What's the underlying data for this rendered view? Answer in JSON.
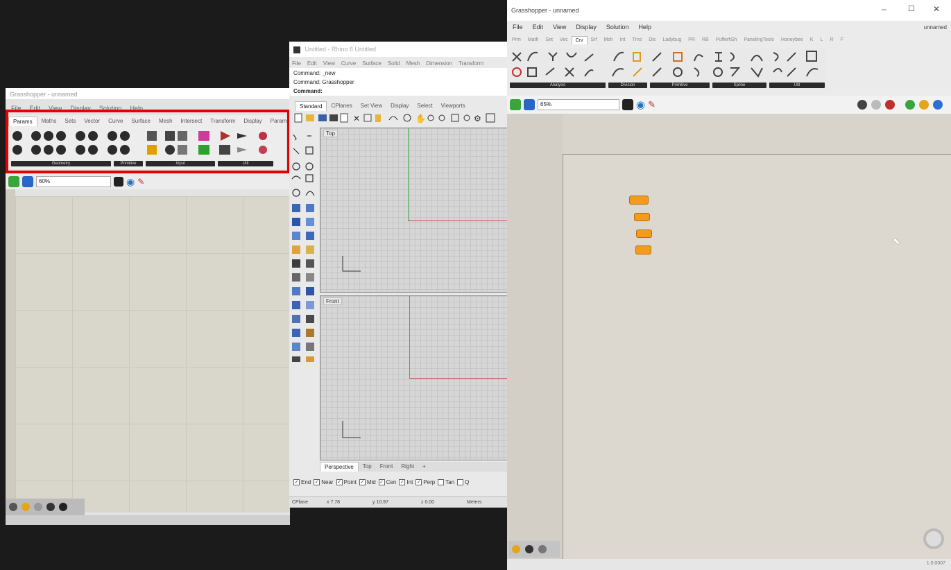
{
  "left_gh": {
    "title": "Grasshopper - unnamed",
    "menu": [
      "File",
      "Edit",
      "View",
      "Display",
      "Solution",
      "Help"
    ],
    "tabs": [
      "Params",
      "Maths",
      "Sets",
      "Vector",
      "Curve",
      "Surface",
      "Mesh",
      "Intersect",
      "Transform",
      "Display",
      "Params"
    ],
    "groups": [
      "Geometry",
      "Primitive",
      "Input",
      "Util"
    ],
    "zoom": "60%"
  },
  "rhino": {
    "title": "Untitled - Rhino 6 Untitled",
    "menu": [
      "File",
      "Edit",
      "View",
      "Curve",
      "Surface",
      "Solid",
      "Mesh",
      "Dimension",
      "Transform"
    ],
    "command_history": [
      "Command: _new",
      "Command: Grasshopper"
    ],
    "command_prompt": "Command:",
    "toolbar_tabs": [
      "Standard",
      "CPlanes",
      "Set View",
      "Display",
      "Select",
      "Viewports"
    ],
    "viewports": [
      "Top",
      "Front"
    ],
    "view_tabs": [
      "Perspective",
      "Top",
      "Front",
      "Right"
    ],
    "snaps": [
      {
        "label": "End",
        "checked": true
      },
      {
        "label": "Near",
        "checked": true
      },
      {
        "label": "Point",
        "checked": true
      },
      {
        "label": "Mid",
        "checked": true
      },
      {
        "label": "Cen",
        "checked": true
      },
      {
        "label": "Int",
        "checked": true
      },
      {
        "label": "Perp",
        "checked": true
      },
      {
        "label": "Tan",
        "checked": false
      },
      {
        "label": "Q",
        "checked": false
      }
    ],
    "status": {
      "cplane": "CPlane",
      "x": "x 7.78",
      "y": "y 10.97",
      "z": "z 0.00",
      "units": "Meters"
    }
  },
  "right_gh": {
    "title": "Grasshopper - unnamed",
    "file_label": "unnamed",
    "menu": [
      "File",
      "Edit",
      "View",
      "Display",
      "Solution",
      "Help"
    ],
    "tabs": [
      "Prm",
      "Math",
      "Set",
      "Vec",
      "Crv",
      "Srf",
      "Msh",
      "Int",
      "Trns",
      "Dis",
      "Ladybug",
      "PR",
      "RB",
      "PufferfiSh",
      "PanelingTools",
      "Honeybee",
      "K",
      "L",
      "R",
      "F"
    ],
    "active_tab": "Crv",
    "groups": [
      "Analysis",
      "Division",
      "Primitive",
      "Spline",
      "Util"
    ],
    "zoom": "65%",
    "version": "1.0.0007"
  },
  "colors": {
    "highlight": "#e30000",
    "component": "#f29b1d",
    "gh_canvas": "#d9d6ce",
    "gh_toolbar": "#e9e9e9"
  }
}
